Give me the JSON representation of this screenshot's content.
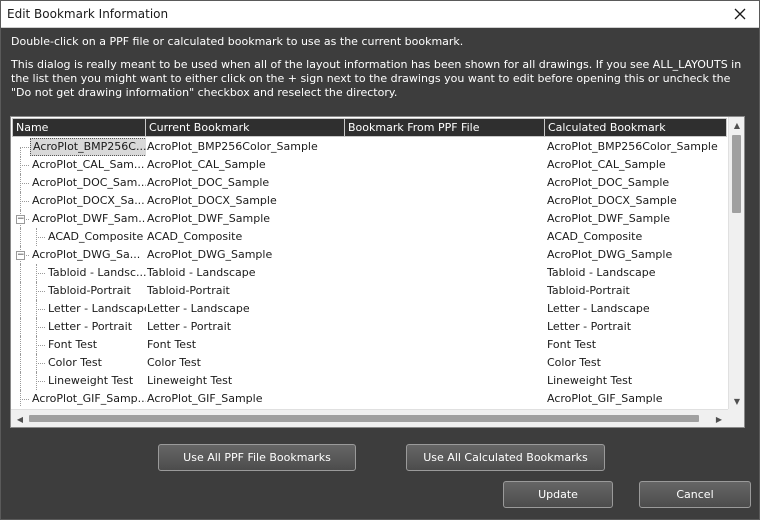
{
  "window": {
    "title": "Edit Bookmark Information",
    "close_icon": "close-icon"
  },
  "description": {
    "line1": "Double-click on a PPF file or calculated bookmark to use as the current bookmark.",
    "line2": "This dialog is really meant to be used when all of the layout information has been shown for all drawings.  If you see ALL_LAYOUTS in the list then you might want to either click on the + sign next to the drawings you want to edit before opening this or uncheck the \"Do not get drawing information\" checkbox and reselect the directory."
  },
  "table": {
    "columns": [
      "Name",
      "Current Bookmark",
      "Bookmark From PPF File",
      "Calculated Bookmark"
    ],
    "rows": [
      {
        "name": "AcroPlot_BMP256C...",
        "current": "AcroPlot_BMP256Color_Sample",
        "ppf": "",
        "calculated": "AcroPlot_BMP256Color_Sample",
        "level": 0,
        "selected": true
      },
      {
        "name": "AcroPlot_CAL_Sam...",
        "current": "AcroPlot_CAL_Sample",
        "ppf": "",
        "calculated": "AcroPlot_CAL_Sample",
        "level": 0
      },
      {
        "name": "AcroPlot_DOC_Sam...",
        "current": "AcroPlot_DOC_Sample",
        "ppf": "",
        "calculated": "AcroPlot_DOC_Sample",
        "level": 0
      },
      {
        "name": "AcroPlot_DOCX_Sa...",
        "current": "AcroPlot_DOCX_Sample",
        "ppf": "",
        "calculated": "AcroPlot_DOCX_Sample",
        "level": 0
      },
      {
        "name": "AcroPlot_DWF_Sam...",
        "current": "AcroPlot_DWF_Sample",
        "ppf": "",
        "calculated": "AcroPlot_DWF_Sample",
        "level": 0,
        "expander": "−"
      },
      {
        "name": "ACAD_Composite",
        "current": "ACAD_Composite",
        "ppf": "",
        "calculated": "ACAD_Composite",
        "level": 1
      },
      {
        "name": "AcroPlot_DWG_Sa...",
        "current": "AcroPlot_DWG_Sample",
        "ppf": "",
        "calculated": "AcroPlot_DWG_Sample",
        "level": 0,
        "expander": "−"
      },
      {
        "name": "Tabloid - Landsc...",
        "current": "Tabloid - Landscape",
        "ppf": "",
        "calculated": "Tabloid - Landscape",
        "level": 1
      },
      {
        "name": "Tabloid-Portrait",
        "current": "Tabloid-Portrait",
        "ppf": "",
        "calculated": "Tabloid-Portrait",
        "level": 1
      },
      {
        "name": "Letter - Landscape",
        "current": "Letter - Landscape",
        "ppf": "",
        "calculated": "Letter - Landscape",
        "level": 1
      },
      {
        "name": "Letter - Portrait",
        "current": "Letter - Portrait",
        "ppf": "",
        "calculated": "Letter - Portrait",
        "level": 1
      },
      {
        "name": "Font Test",
        "current": "Font Test",
        "ppf": "",
        "calculated": "Font Test",
        "level": 1
      },
      {
        "name": "Color Test",
        "current": "Color Test",
        "ppf": "",
        "calculated": "Color Test",
        "level": 1
      },
      {
        "name": "Lineweight Test",
        "current": "Lineweight Test",
        "ppf": "",
        "calculated": "Lineweight Test",
        "level": 1
      },
      {
        "name": "AcroPlot_GIF_Samp...",
        "current": "AcroPlot_GIF_Sample",
        "ppf": "",
        "calculated": "AcroPlot_GIF_Sample",
        "level": 0
      }
    ]
  },
  "buttons": {
    "use_ppf": "Use All PPF File Bookmarks",
    "use_calc": "Use All Calculated Bookmarks",
    "update": "Update",
    "cancel": "Cancel"
  },
  "colors": {
    "dialog_bg": "#3d3d3d",
    "header_bg": "#2f2f2f",
    "button_bg": "#555555"
  }
}
